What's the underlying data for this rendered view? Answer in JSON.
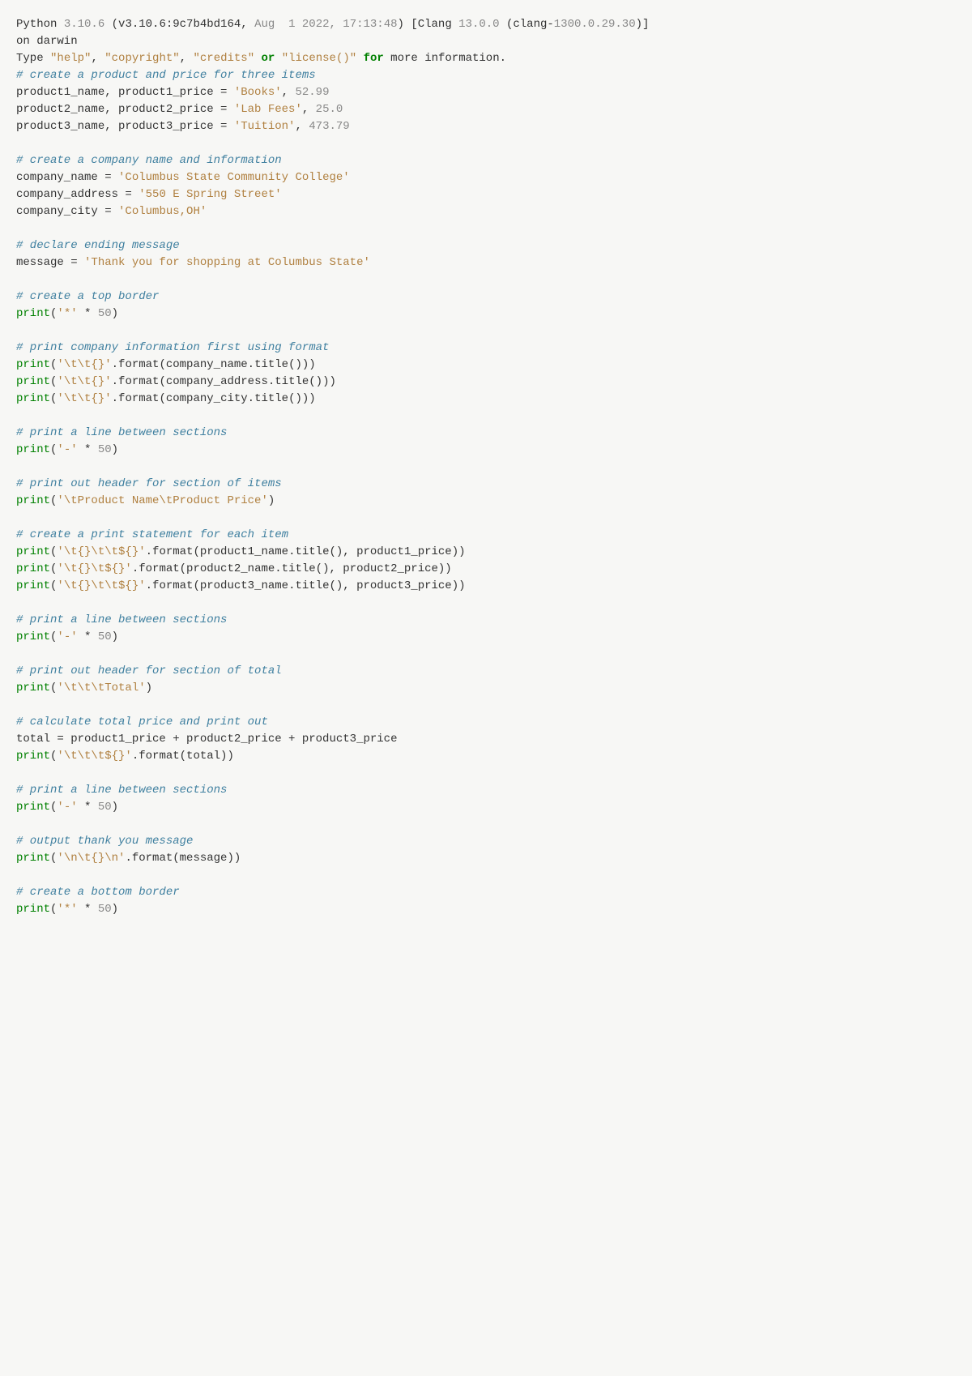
{
  "lines": [
    {
      "type": "plain",
      "tokens": [
        {
          "cls": "t",
          "text": "Python "
        },
        {
          "cls": "num",
          "text": "3.10.6"
        },
        {
          "cls": "t",
          "text": " (v3.10.6:9c7b4bd164, "
        },
        {
          "cls": "dt",
          "text": "Aug  1 2022, 17:13:48"
        },
        {
          "cls": "t",
          "text": ") [Clang "
        },
        {
          "cls": "num",
          "text": "13.0.0"
        },
        {
          "cls": "t",
          "text": " (clang-"
        },
        {
          "cls": "num",
          "text": "1300.0.29.30"
        },
        {
          "cls": "t",
          "text": ")]"
        }
      ]
    },
    {
      "type": "plain",
      "tokens": [
        {
          "cls": "t",
          "text": "on darwin"
        }
      ]
    },
    {
      "type": "plain",
      "tokens": [
        {
          "cls": "t",
          "text": "Type "
        },
        {
          "cls": "str",
          "text": "\"help\""
        },
        {
          "cls": "t",
          "text": ", "
        },
        {
          "cls": "str",
          "text": "\"copyright\""
        },
        {
          "cls": "t",
          "text": ", "
        },
        {
          "cls": "str",
          "text": "\"credits\""
        },
        {
          "cls": "t",
          "text": " "
        },
        {
          "cls": "kw",
          "text": "or"
        },
        {
          "cls": "t",
          "text": " "
        },
        {
          "cls": "str",
          "text": "\"license()\""
        },
        {
          "cls": "t",
          "text": " "
        },
        {
          "cls": "kw",
          "text": "for"
        },
        {
          "cls": "t",
          "text": " more information."
        }
      ]
    },
    {
      "type": "comment",
      "text": "# create a product and price for three items"
    },
    {
      "type": "plain",
      "tokens": [
        {
          "cls": "t",
          "text": "product1_name, product1_price = "
        },
        {
          "cls": "str",
          "text": "'Books'"
        },
        {
          "cls": "t",
          "text": ", "
        },
        {
          "cls": "num",
          "text": "52.99"
        }
      ]
    },
    {
      "type": "plain",
      "tokens": [
        {
          "cls": "t",
          "text": "product2_name, product2_price = "
        },
        {
          "cls": "str",
          "text": "'Lab Fees'"
        },
        {
          "cls": "t",
          "text": ", "
        },
        {
          "cls": "num",
          "text": "25.0"
        }
      ]
    },
    {
      "type": "plain",
      "tokens": [
        {
          "cls": "t",
          "text": "product3_name, product3_price = "
        },
        {
          "cls": "str",
          "text": "'Tuition'"
        },
        {
          "cls": "t",
          "text": ", "
        },
        {
          "cls": "num",
          "text": "473.79"
        }
      ]
    },
    {
      "type": "blank"
    },
    {
      "type": "comment",
      "text": "# create a company name and information"
    },
    {
      "type": "plain",
      "tokens": [
        {
          "cls": "t",
          "text": "company_name = "
        },
        {
          "cls": "str",
          "text": "'Columbus State Community College'"
        }
      ]
    },
    {
      "type": "plain",
      "tokens": [
        {
          "cls": "t",
          "text": "company_address = "
        },
        {
          "cls": "str",
          "text": "'550 E Spring Street'"
        }
      ]
    },
    {
      "type": "plain",
      "tokens": [
        {
          "cls": "t",
          "text": "company_city = "
        },
        {
          "cls": "str",
          "text": "'Columbus,OH'"
        }
      ]
    },
    {
      "type": "blank"
    },
    {
      "type": "comment",
      "text": "# declare ending message"
    },
    {
      "type": "plain",
      "tokens": [
        {
          "cls": "t",
          "text": "message = "
        },
        {
          "cls": "str",
          "text": "'Thank you for shopping at Columbus State'"
        }
      ]
    },
    {
      "type": "blank"
    },
    {
      "type": "comment",
      "text": "# create a top border"
    },
    {
      "type": "plain",
      "tokens": [
        {
          "cls": "bi",
          "text": "print"
        },
        {
          "cls": "t",
          "text": "("
        },
        {
          "cls": "str",
          "text": "'*'"
        },
        {
          "cls": "t",
          "text": " * "
        },
        {
          "cls": "num",
          "text": "50"
        },
        {
          "cls": "t",
          "text": ")"
        }
      ]
    },
    {
      "type": "blank"
    },
    {
      "type": "comment",
      "text": "# print company information first using format"
    },
    {
      "type": "plain",
      "tokens": [
        {
          "cls": "bi",
          "text": "print"
        },
        {
          "cls": "t",
          "text": "("
        },
        {
          "cls": "str",
          "text": "'\\t\\t{}'"
        },
        {
          "cls": "t",
          "text": ".format(company_name.title()))"
        }
      ]
    },
    {
      "type": "plain",
      "tokens": [
        {
          "cls": "bi",
          "text": "print"
        },
        {
          "cls": "t",
          "text": "("
        },
        {
          "cls": "str",
          "text": "'\\t\\t{}'"
        },
        {
          "cls": "t",
          "text": ".format(company_address.title()))"
        }
      ]
    },
    {
      "type": "plain",
      "tokens": [
        {
          "cls": "bi",
          "text": "print"
        },
        {
          "cls": "t",
          "text": "("
        },
        {
          "cls": "str",
          "text": "'\\t\\t{}'"
        },
        {
          "cls": "t",
          "text": ".format(company_city.title()))"
        }
      ]
    },
    {
      "type": "blank"
    },
    {
      "type": "comment",
      "text": "# print a line between sections"
    },
    {
      "type": "plain",
      "tokens": [
        {
          "cls": "bi",
          "text": "print"
        },
        {
          "cls": "t",
          "text": "("
        },
        {
          "cls": "str",
          "text": "'-'"
        },
        {
          "cls": "t",
          "text": " * "
        },
        {
          "cls": "num",
          "text": "50"
        },
        {
          "cls": "t",
          "text": ")"
        }
      ]
    },
    {
      "type": "blank"
    },
    {
      "type": "comment",
      "text": "# print out header for section of items"
    },
    {
      "type": "plain",
      "tokens": [
        {
          "cls": "bi",
          "text": "print"
        },
        {
          "cls": "t",
          "text": "("
        },
        {
          "cls": "str",
          "text": "'\\tProduct Name\\tProduct Price'"
        },
        {
          "cls": "t",
          "text": ")"
        }
      ]
    },
    {
      "type": "blank"
    },
    {
      "type": "comment",
      "text": "# create a print statement for each item"
    },
    {
      "type": "plain",
      "tokens": [
        {
          "cls": "bi",
          "text": "print"
        },
        {
          "cls": "t",
          "text": "("
        },
        {
          "cls": "str",
          "text": "'\\t{}\\t\\t${}'"
        },
        {
          "cls": "t",
          "text": ".format(product1_name.title(), product1_price))"
        }
      ]
    },
    {
      "type": "plain",
      "tokens": [
        {
          "cls": "bi",
          "text": "print"
        },
        {
          "cls": "t",
          "text": "("
        },
        {
          "cls": "str",
          "text": "'\\t{}\\t${}'"
        },
        {
          "cls": "t",
          "text": ".format(product2_name.title(), product2_price))"
        }
      ]
    },
    {
      "type": "plain",
      "tokens": [
        {
          "cls": "bi",
          "text": "print"
        },
        {
          "cls": "t",
          "text": "("
        },
        {
          "cls": "str",
          "text": "'\\t{}\\t\\t${}'"
        },
        {
          "cls": "t",
          "text": ".format(product3_name.title(), product3_price))"
        }
      ]
    },
    {
      "type": "blank"
    },
    {
      "type": "comment",
      "text": "# print a line between sections"
    },
    {
      "type": "plain",
      "tokens": [
        {
          "cls": "bi",
          "text": "print"
        },
        {
          "cls": "t",
          "text": "("
        },
        {
          "cls": "str",
          "text": "'-'"
        },
        {
          "cls": "t",
          "text": " * "
        },
        {
          "cls": "num",
          "text": "50"
        },
        {
          "cls": "t",
          "text": ")"
        }
      ]
    },
    {
      "type": "blank"
    },
    {
      "type": "comment",
      "text": "# print out header for section of total"
    },
    {
      "type": "plain",
      "tokens": [
        {
          "cls": "bi",
          "text": "print"
        },
        {
          "cls": "t",
          "text": "("
        },
        {
          "cls": "str",
          "text": "'\\t\\t\\tTotal'"
        },
        {
          "cls": "t",
          "text": ")"
        }
      ]
    },
    {
      "type": "blank"
    },
    {
      "type": "comment",
      "text": "# calculate total price and print out"
    },
    {
      "type": "plain",
      "tokens": [
        {
          "cls": "t",
          "text": "total = product1_price + product2_price + product3_price"
        }
      ]
    },
    {
      "type": "plain",
      "tokens": [
        {
          "cls": "bi",
          "text": "print"
        },
        {
          "cls": "t",
          "text": "("
        },
        {
          "cls": "str",
          "text": "'\\t\\t\\t${}'"
        },
        {
          "cls": "t",
          "text": ".format(total))"
        }
      ]
    },
    {
      "type": "blank"
    },
    {
      "type": "comment",
      "text": "# print a line between sections"
    },
    {
      "type": "plain",
      "tokens": [
        {
          "cls": "bi",
          "text": "print"
        },
        {
          "cls": "t",
          "text": "("
        },
        {
          "cls": "str",
          "text": "'-'"
        },
        {
          "cls": "t",
          "text": " * "
        },
        {
          "cls": "num",
          "text": "50"
        },
        {
          "cls": "t",
          "text": ")"
        }
      ]
    },
    {
      "type": "blank"
    },
    {
      "type": "comment",
      "text": "# output thank you message"
    },
    {
      "type": "plain",
      "tokens": [
        {
          "cls": "bi",
          "text": "print"
        },
        {
          "cls": "t",
          "text": "("
        },
        {
          "cls": "str",
          "text": "'\\n\\t{}\\n'"
        },
        {
          "cls": "t",
          "text": ".format(message))"
        }
      ]
    },
    {
      "type": "blank"
    },
    {
      "type": "comment",
      "text": "# create a bottom border"
    },
    {
      "type": "plain",
      "tokens": [
        {
          "cls": "bi",
          "text": "print"
        },
        {
          "cls": "t",
          "text": "("
        },
        {
          "cls": "str",
          "text": "'*'"
        },
        {
          "cls": "t",
          "text": " * "
        },
        {
          "cls": "num",
          "text": "50"
        },
        {
          "cls": "t",
          "text": ")"
        }
      ]
    }
  ]
}
